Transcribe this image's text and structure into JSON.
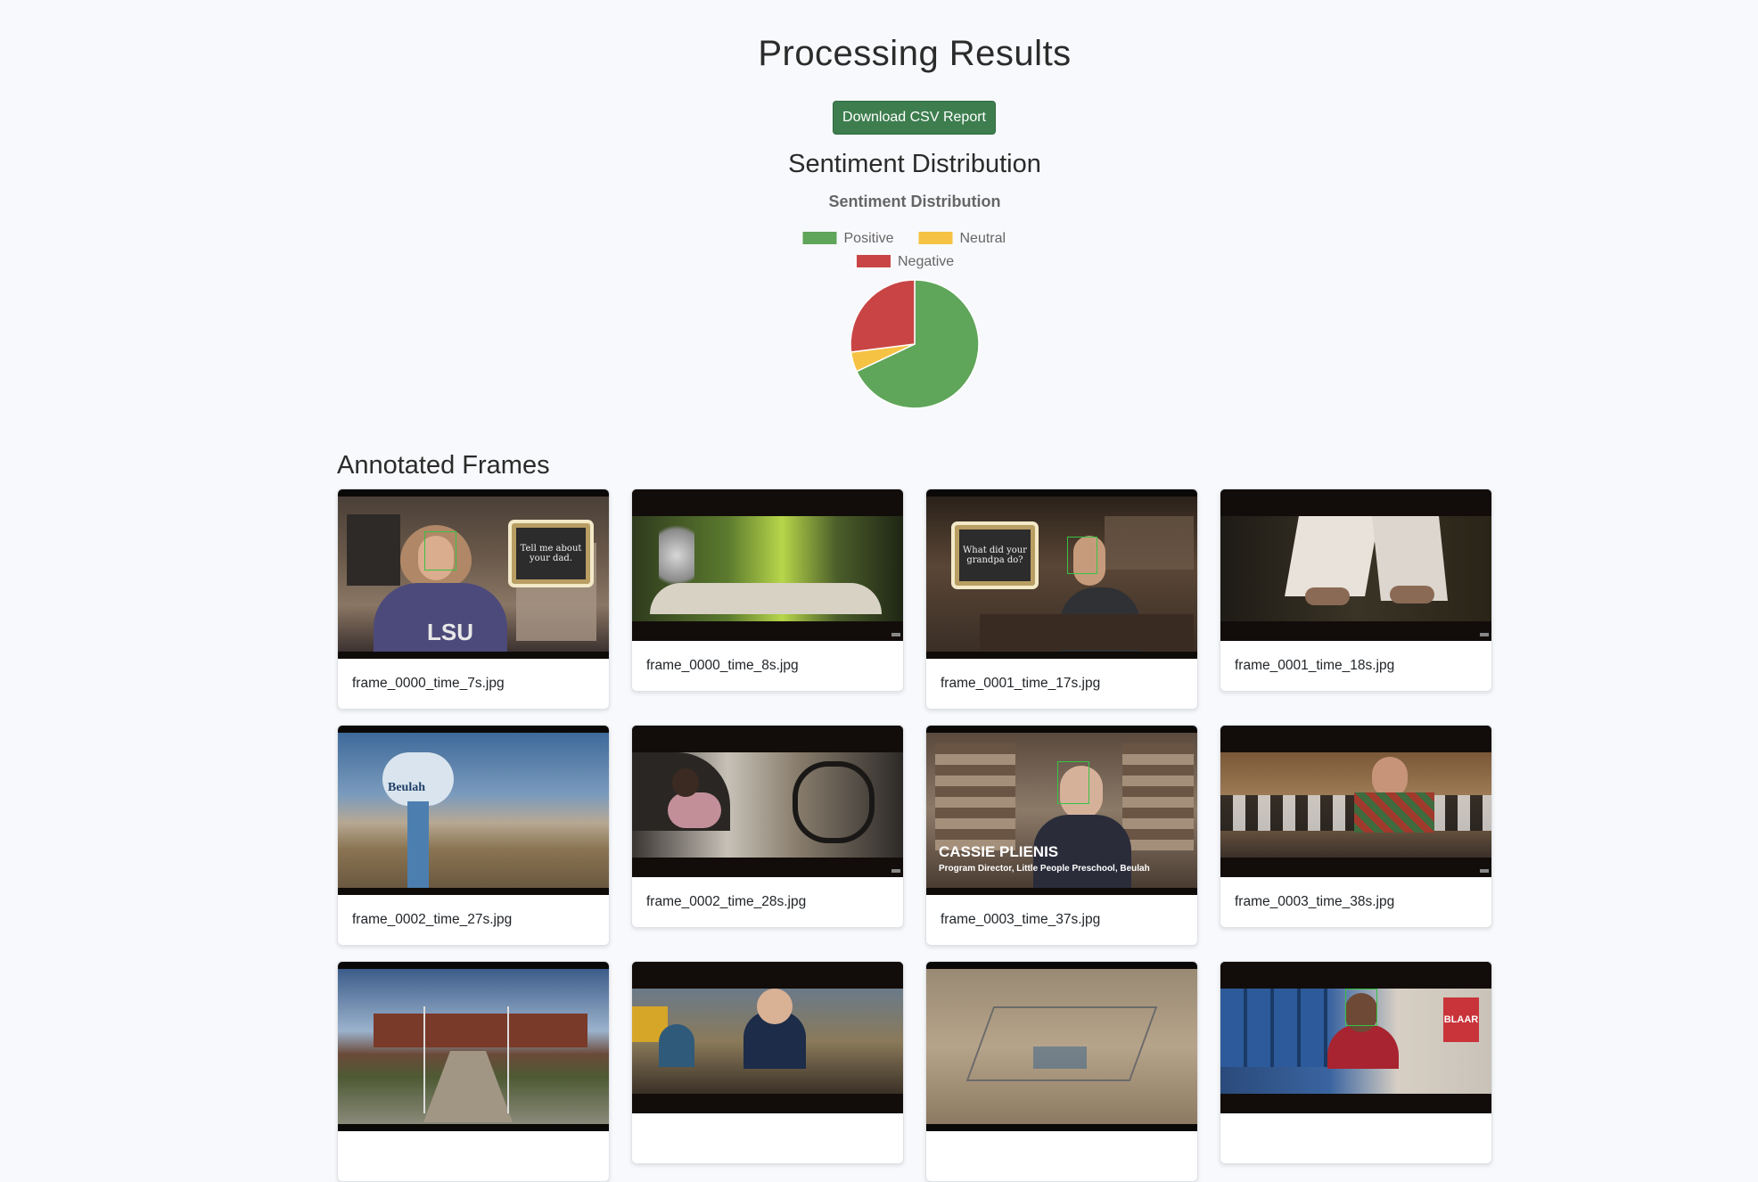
{
  "header": {
    "title": "Processing Results"
  },
  "actions": {
    "download_label": "Download CSV Report"
  },
  "sentiment": {
    "section_title": "Sentiment Distribution"
  },
  "chart_data": {
    "type": "pie",
    "title": "Sentiment Distribution",
    "legend_position": "top",
    "categories": [
      "Positive",
      "Neutral",
      "Negative"
    ],
    "values": [
      68,
      5,
      27
    ],
    "colors": [
      "#5fa55a",
      "#f6c244",
      "#c94545"
    ]
  },
  "frames": {
    "section_title": "Annotated Frames",
    "items": [
      {
        "filename": "frame_0000_time_7s.jpg",
        "overlay_text": "Tell me about your dad.",
        "lettering": "LSU"
      },
      {
        "filename": "frame_0000_time_8s.jpg"
      },
      {
        "filename": "frame_0001_time_17s.jpg",
        "overlay_text": "What did your grandpa do?"
      },
      {
        "filename": "frame_0001_time_18s.jpg"
      },
      {
        "filename": "frame_0002_time_27s.jpg",
        "lettering": "Beulah"
      },
      {
        "filename": "frame_0002_time_28s.jpg"
      },
      {
        "filename": "frame_0003_time_37s.jpg",
        "name_title": "CASSIE PLIENIS",
        "name_subtitle": "Program Director, Little People Preschool, Beulah"
      },
      {
        "filename": "frame_0003_time_38s.jpg"
      },
      {
        "filename": ""
      },
      {
        "filename": ""
      },
      {
        "filename": ""
      },
      {
        "filename": "",
        "lettering": "BLAAR"
      }
    ]
  }
}
